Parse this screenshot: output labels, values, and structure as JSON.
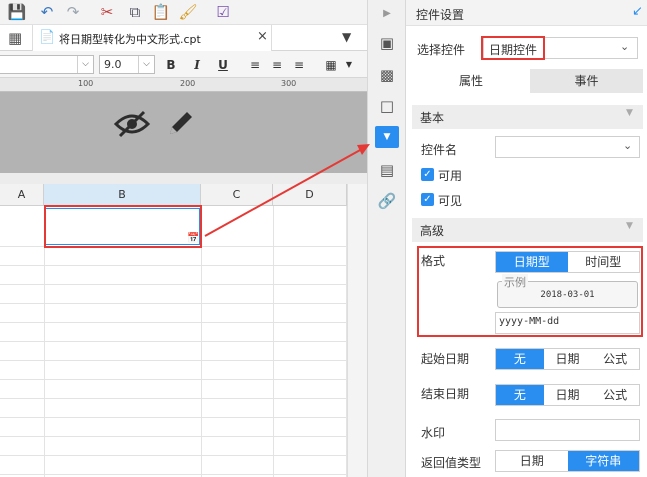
{
  "toolbar": {
    "icons": [
      "save-icon",
      "undo-icon",
      "redo-icon",
      "cut-icon",
      "copy-icon",
      "paste-icon",
      "format-brush-icon",
      "template-icon"
    ]
  },
  "tab": {
    "title": "将日期型转化为中文形式.cpt",
    "close": "×"
  },
  "format": {
    "font": "",
    "size": "9.0",
    "bold": "B",
    "italic": "I",
    "underline": "U"
  },
  "ruler": {
    "marks": [
      "100",
      "200",
      "300"
    ]
  },
  "columns": [
    "A",
    "B",
    "C",
    "D"
  ],
  "panel": {
    "title": "控件设置",
    "select_label": "选择控件",
    "select_value": "日期控件",
    "tabs": [
      "属性",
      "事件"
    ],
    "basic_section": "基本",
    "name_label": "控件名",
    "name_value": "",
    "enabled_label": "可用",
    "visible_label": "可见",
    "advanced_section": "高级",
    "format_label": "格式",
    "format_types": [
      "日期型",
      "时间型"
    ],
    "example_legend": "示例",
    "example_value": "2018-03-01",
    "format_pattern": "yyyy-MM-dd",
    "start_label": "起始日期",
    "end_label": "结束日期",
    "date_options": [
      "无",
      "日期",
      "公式"
    ],
    "watermark_label": "水印",
    "watermark_value": "",
    "return_label": "返回值类型",
    "return_options": [
      "日期",
      "字符串"
    ]
  },
  "colors": {
    "accent": "#2a8ef0",
    "highlight": "#e53935",
    "selected_header": "#d7e9f7"
  }
}
